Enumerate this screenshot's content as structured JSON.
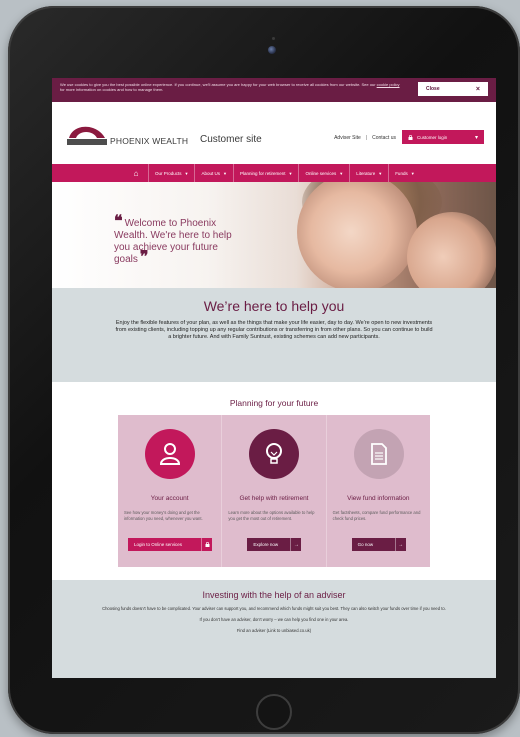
{
  "cookie": {
    "text": "We use cookies to give you the best possible online experience. If you continue, we'll assume you are happy for your web browser to receive all cookies from our website. See our ",
    "link": "cookie policy",
    "text2": " for more information on cookies and how to manage them.",
    "close_label": "Close",
    "close_icon": "×"
  },
  "header": {
    "adviser_link": "Adviser Site",
    "separator": "|",
    "contact_link": "Contact us",
    "login_label": "Customer login",
    "logo_text": "PHOENIX WEALTH",
    "site_label": "Customer site"
  },
  "nav": {
    "home_icon": "⌂",
    "items": [
      {
        "label": "Our Products"
      },
      {
        "label": "About Us"
      },
      {
        "label": "Planning for retirement"
      },
      {
        "label": "Online services"
      },
      {
        "label": "Literature"
      },
      {
        "label": "Funds"
      }
    ]
  },
  "hero": {
    "open_quote": "❝",
    "quote": "Welcome to Phoenix Wealth. We're here to help you achieve your future goals",
    "close_quote": "❞"
  },
  "help": {
    "title": "We’re here to help you",
    "body": "Enjoy the flexible features of your plan, as well as the things that make your life easier, day to day. We’re open to new investments from existing clients, including topping up any regular contributions or transferring in from other plans. So you can continue to build a brighter future. And with Family Suntrust, existing schemes can add new participants."
  },
  "planning": {
    "title": "Planning for your future",
    "cards": [
      {
        "title": "Your account",
        "text": "See how your money’s doing and get the information you need, whenever you want.",
        "button": "Login to Online services",
        "icon": "user-icon",
        "color": "#c2185b"
      },
      {
        "title": "Get help with retirement",
        "text": "Learn more about the options available to help you get the most out of retirement.",
        "button": "Explore now",
        "icon": "lightbulb-icon",
        "color": "#6a1d44"
      },
      {
        "title": "View fund information",
        "text": "Get factsheets, compare fund performance and check fund prices.",
        "button": "Go now",
        "icon": "document-icon",
        "color": "#c3a3b3"
      }
    ]
  },
  "adviser": {
    "title": "Investing with the help of an adviser",
    "p1": "Choosing funds doesn't have to be complicated. Your adviser can support you, and recommend which funds might suit you best. They can also switch your funds over time if you need to.",
    "p2": "If you don't have an adviser, don't worry – we can help you find one in your area.",
    "p3": "Find an adviser (Link to unbiased.co.uk)"
  }
}
